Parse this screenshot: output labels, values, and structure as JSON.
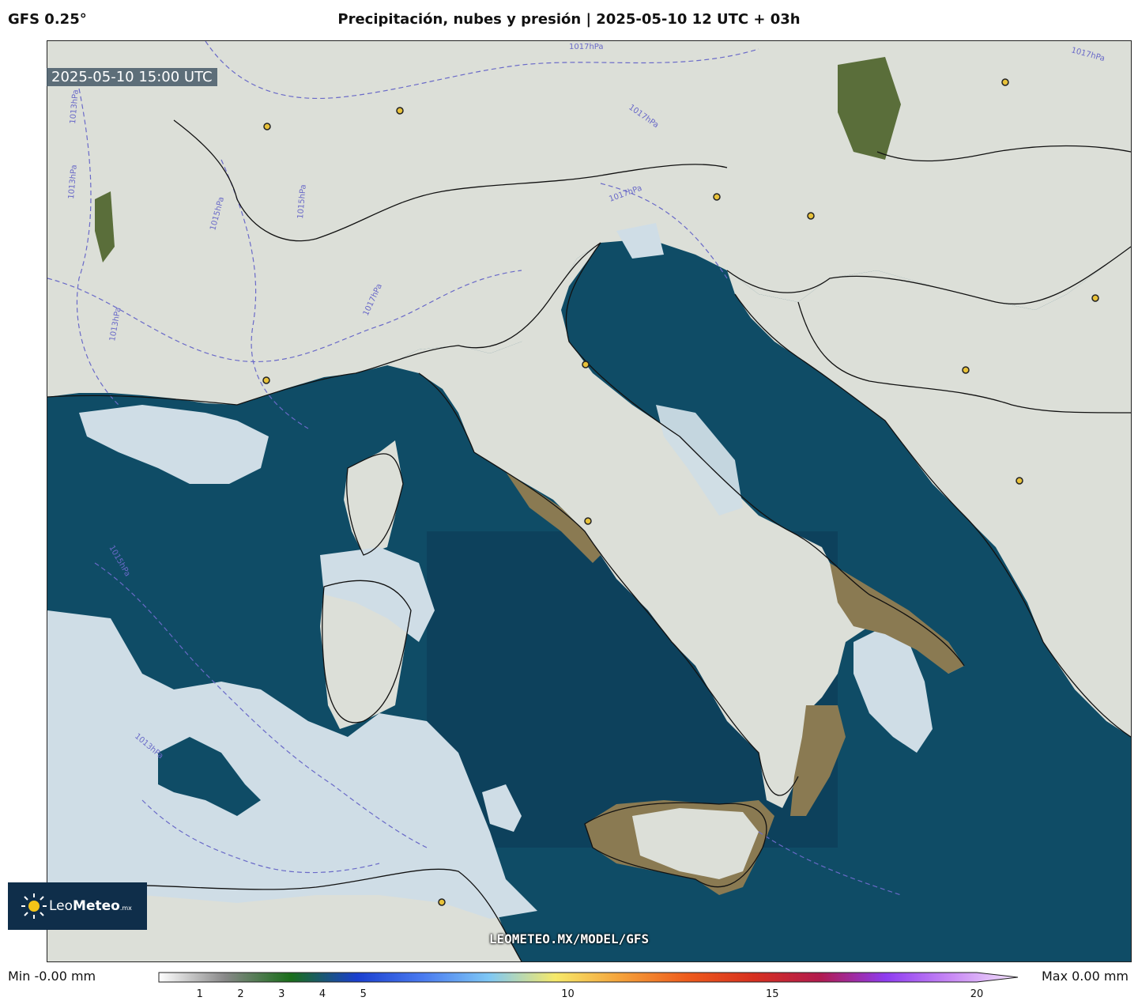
{
  "header": {
    "model": "GFS 0.25°",
    "title": "Precipitación, nubes y presión | 2025-05-10 12 UTC + 03h"
  },
  "map": {
    "timestamp": "2025-05-10 15:00 UTC",
    "watermark": "LEOMETEO.MX/MODEL/GFS",
    "isobar_labels": [
      "1017hPa",
      "1017hPa",
      "1017hPa",
      "1017hPa",
      "1017hPa",
      "1015hPa",
      "1013hPa",
      "1013hPa",
      "1015hPa",
      "1013hPa",
      "1015hPa",
      "1013hPa"
    ],
    "colors": {
      "sea": "#0f4c66",
      "deep_sea": "#0c3a55",
      "land": "#dcdfd8",
      "cloud": "#cfdde6",
      "terrain": "#8a7a52",
      "isobar": "#6a6ac8"
    }
  },
  "logo": {
    "name_light": "Leo",
    "name_bold": "Meteo",
    "suffix": ".mx"
  },
  "legend": {
    "min": "Min -0.00 mm",
    "max": "Max 0.00 mm",
    "ticks": [
      "1",
      "2",
      "3",
      "4",
      "5",
      "10",
      "15",
      "20"
    ],
    "scale": [
      0,
      20
    ],
    "colors": [
      "#ffffff",
      "#888888",
      "#1a6e1a",
      "#1a3fcf",
      "#4a7bf0",
      "#7fc8f5",
      "#f6e96a",
      "#f5a13a",
      "#ee5b1c",
      "#d7301f",
      "#b21b4e",
      "#8e3cf0",
      "#c98af5",
      "#f3e3fb"
    ]
  }
}
